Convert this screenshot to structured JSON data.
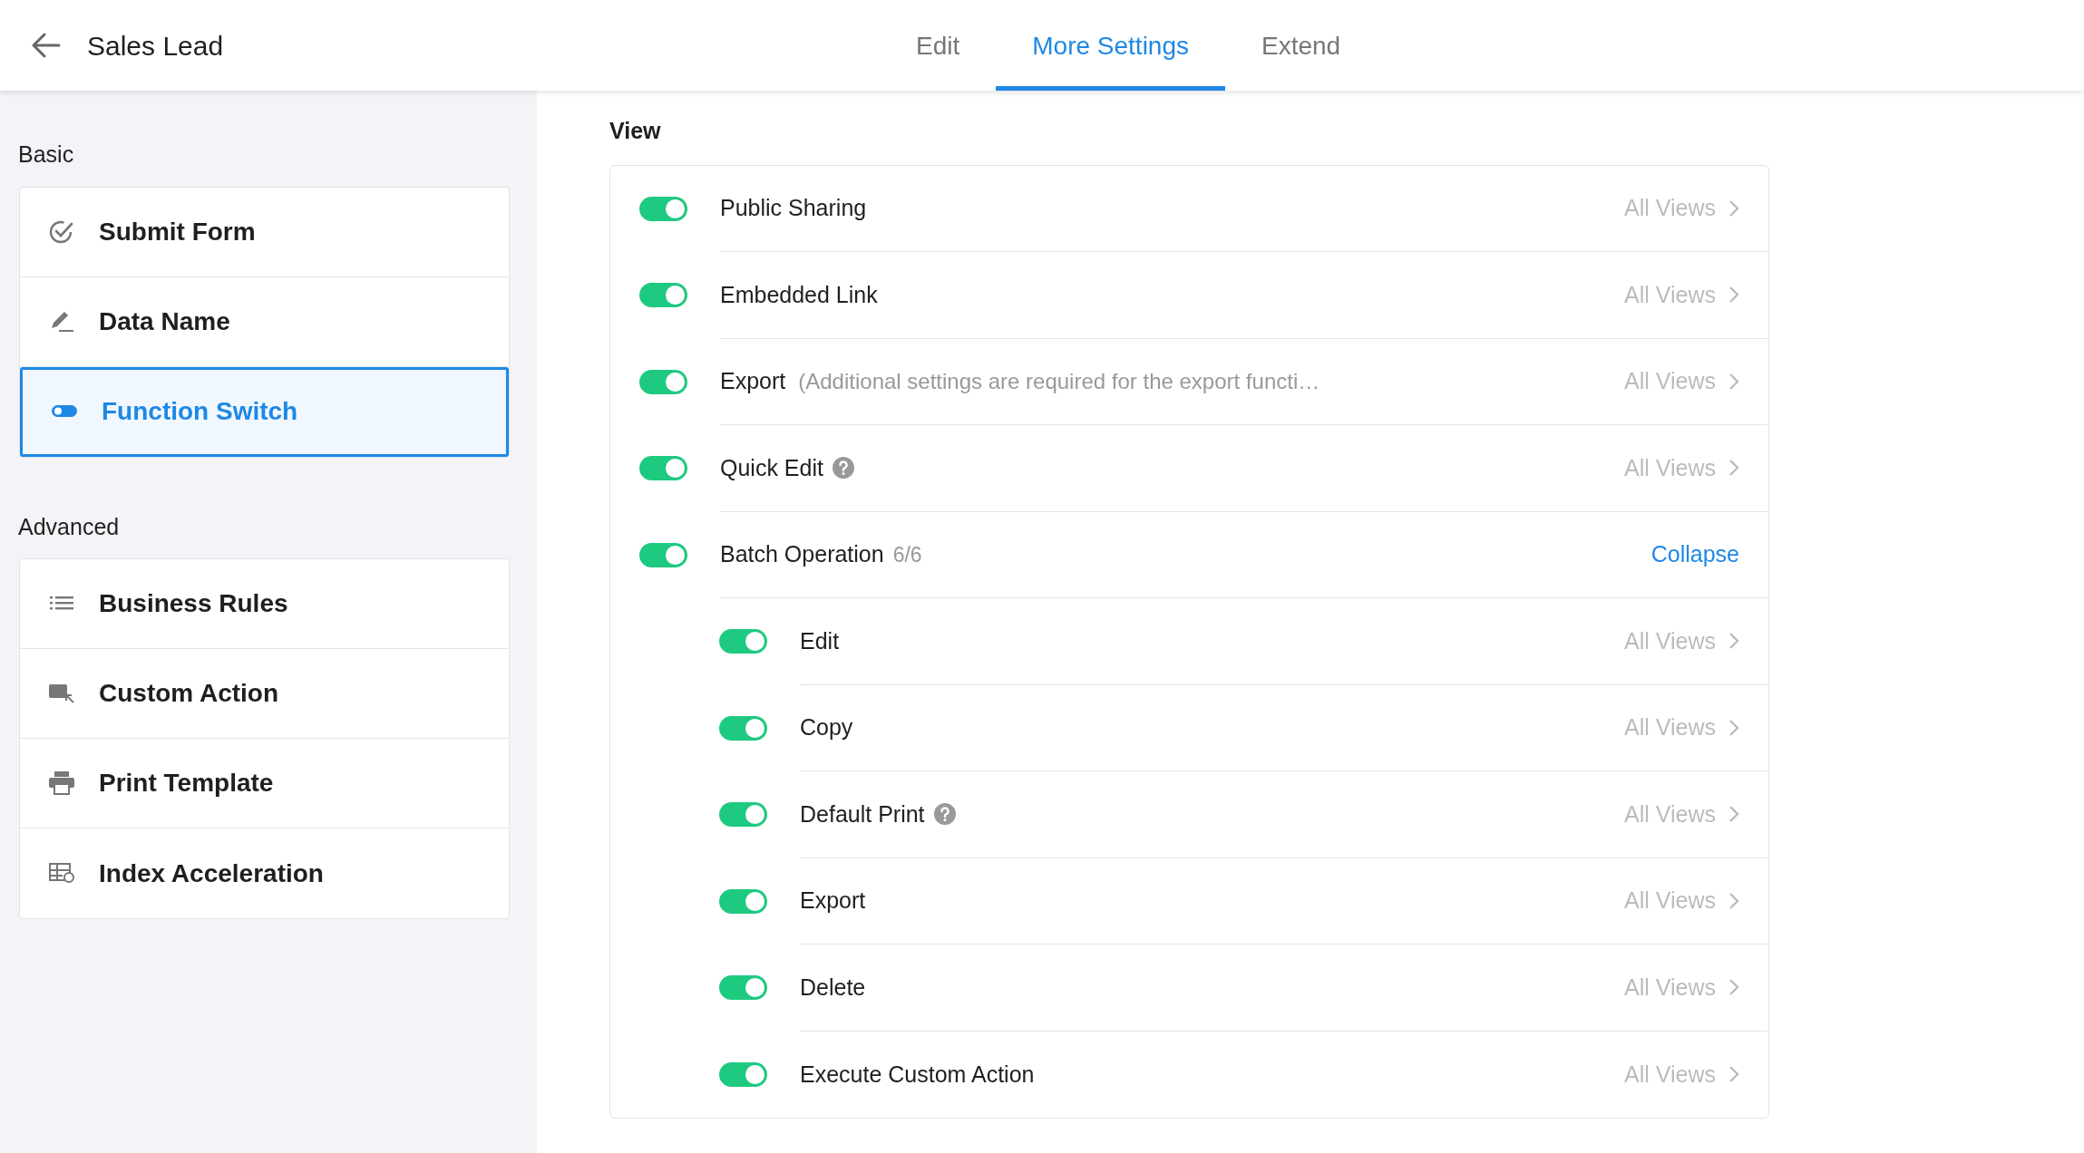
{
  "header": {
    "title": "Sales Lead",
    "tabs": [
      {
        "label": "Edit",
        "selected": false
      },
      {
        "label": "More Settings",
        "selected": true
      },
      {
        "label": "Extend",
        "selected": false
      }
    ]
  },
  "sidebar": {
    "sections": [
      {
        "heading": "Basic",
        "items": [
          {
            "kind": "submit",
            "label": "Submit Form",
            "selected": false
          },
          {
            "kind": "rename",
            "label": "Data Name",
            "selected": false
          },
          {
            "kind": "switch",
            "label": "Function Switch",
            "selected": true
          }
        ]
      },
      {
        "heading": "Advanced",
        "items": [
          {
            "kind": "rules",
            "label": "Business Rules",
            "selected": false
          },
          {
            "kind": "action",
            "label": "Custom Action",
            "selected": false
          },
          {
            "kind": "print",
            "label": "Print Template",
            "selected": false
          },
          {
            "kind": "index",
            "label": "Index Acceleration",
            "selected": false
          }
        ]
      }
    ]
  },
  "main": {
    "section_title": "View",
    "settings": [
      {
        "label": "Public Sharing",
        "on": true,
        "help": false,
        "scope": "All Views"
      },
      {
        "label": "Embedded Link",
        "on": true,
        "help": false,
        "scope": "All Views"
      },
      {
        "label": "Export",
        "note": "(Additional settings are required for the export functi…",
        "on": true,
        "help": false,
        "scope": "All Views"
      },
      {
        "label": "Quick Edit",
        "on": true,
        "help": true,
        "scope": "All Views"
      },
      {
        "label": "Batch Operation",
        "count": "6/6",
        "on": true,
        "help": false,
        "action": "Collapse",
        "children": [
          {
            "label": "Edit",
            "on": true,
            "help": false,
            "scope": "All Views"
          },
          {
            "label": "Copy",
            "on": true,
            "help": false,
            "scope": "All Views"
          },
          {
            "label": "Default Print",
            "on": true,
            "help": true,
            "scope": "All Views"
          },
          {
            "label": "Export",
            "on": true,
            "help": false,
            "scope": "All Views"
          },
          {
            "label": "Delete",
            "on": true,
            "help": false,
            "scope": "All Views"
          },
          {
            "label": "Execute Custom Action",
            "on": true,
            "help": false,
            "scope": "All Views"
          }
        ]
      }
    ]
  }
}
